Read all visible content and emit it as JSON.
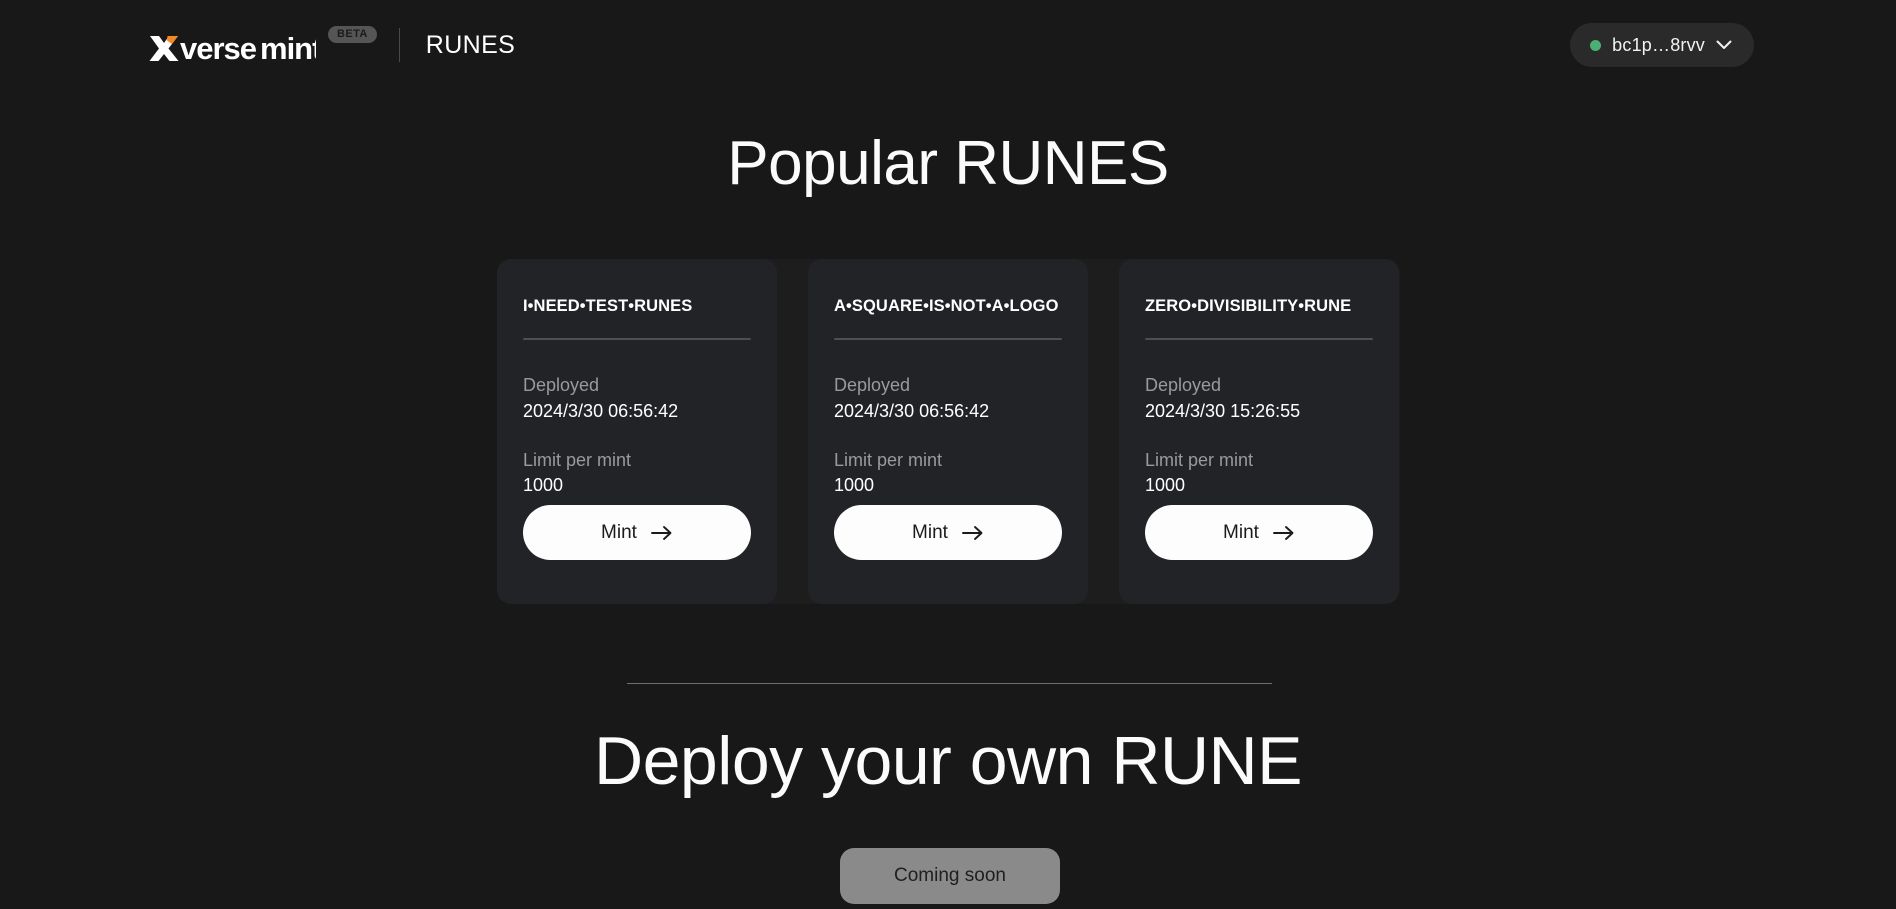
{
  "header": {
    "logo_text": "xverse mint",
    "logo_accent_color": "#f5871f",
    "beta_badge": "BETA",
    "section_name": "RUNES",
    "wallet": {
      "address": "bc1p…8rvv",
      "status_color": "#4caf74",
      "status_dot_icon": "status-dot-icon",
      "chevron_icon": "chevron-down-icon"
    }
  },
  "main": {
    "title": "Popular RUNES",
    "labels": {
      "deployed": "Deployed",
      "limit_per_mint": "Limit per mint",
      "mint": "Mint",
      "arrow_icon": "arrow-right-icon"
    },
    "runes": [
      {
        "name": "I•NEED•TEST•RUNES",
        "deployed": "2024/3/30 06:56:42",
        "limit_per_mint": "1000"
      },
      {
        "name": "A•SQUARE•IS•NOT•A•LOGO",
        "deployed": "2024/3/30 06:56:42",
        "limit_per_mint": "1000"
      },
      {
        "name": "ZERO•DIVISIBILITY•RUNE",
        "deployed": "2024/3/30 15:26:55",
        "limit_per_mint": "1000"
      }
    ]
  },
  "deploy_section": {
    "title": "Deploy your own RUNE",
    "button_label": "Coming soon"
  },
  "colors": {
    "page_bg": "#181818",
    "card_bg": "#212326",
    "cards_container_bg": "#1d1d1d",
    "mint_button_bg": "#fdfdfd",
    "coming_soon_bg": "#8a8a8a",
    "muted_text": "#9a9a9a"
  }
}
